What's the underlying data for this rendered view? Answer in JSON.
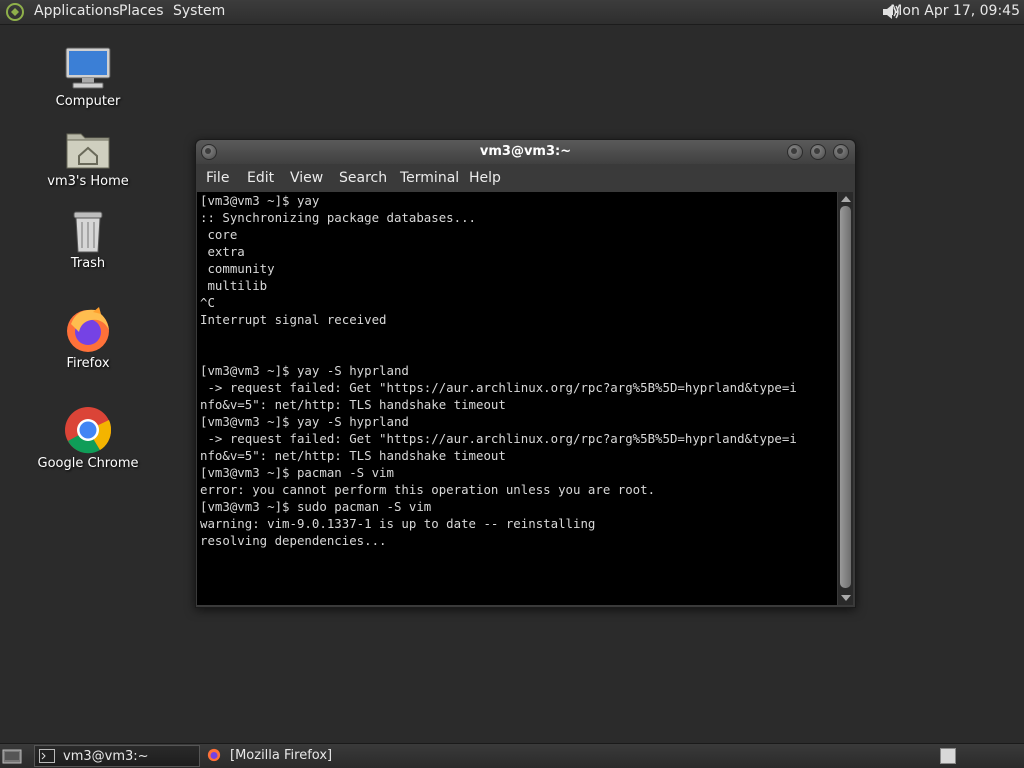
{
  "top_panel": {
    "menus": [
      "Applications",
      "Places",
      "System"
    ],
    "clock": "Mon Apr 17, 09:45",
    "logo_icon": "distro-logo-icon",
    "sound_icon": "speaker-icon"
  },
  "desktop_icons": [
    {
      "label": "Computer",
      "icon": "computer-icon"
    },
    {
      "label": "vm3's Home",
      "icon": "home-folder-icon"
    },
    {
      "label": "Trash",
      "icon": "trash-icon"
    },
    {
      "label": "Firefox",
      "icon": "firefox-icon"
    },
    {
      "label": "Google Chrome",
      "icon": "chrome-icon"
    }
  ],
  "window": {
    "title": "vm3@vm3:~",
    "menu": [
      "File",
      "Edit",
      "View",
      "Search",
      "Terminal",
      "Help"
    ],
    "terminal_lines": [
      "[vm3@vm3 ~]$ yay",
      ":: Synchronizing package databases...",
      " core",
      " extra",
      " community",
      " multilib",
      "^C",
      "Interrupt signal received",
      "",
      "",
      "[vm3@vm3 ~]$ yay -S hyprland",
      " -> request failed: Get \"https://aur.archlinux.org/rpc?arg%5B%5D=hyprland&type=i",
      "nfo&v=5\": net/http: TLS handshake timeout",
      "[vm3@vm3 ~]$ yay -S hyprland",
      " -> request failed: Get \"https://aur.archlinux.org/rpc?arg%5B%5D=hyprland&type=i",
      "nfo&v=5\": net/http: TLS handshake timeout",
      "[vm3@vm3 ~]$ pacman -S vim",
      "error: you cannot perform this operation unless you are root.",
      "[vm3@vm3 ~]$ sudo pacman -S vim",
      "warning: vim-9.0.1337-1 is up to date -- reinstalling",
      "resolving dependencies..."
    ]
  },
  "taskbar": {
    "tasks": [
      {
        "label": "vm3@vm3:~",
        "icon": "terminal-icon",
        "active": true
      },
      {
        "label": "[Mozilla Firefox]",
        "icon": "firefox-icon",
        "active": false
      }
    ]
  },
  "colors": {
    "desktop_bg": "#2b2b2b",
    "terminal_bg": "#000000",
    "terminal_fg": "#d8d8d8",
    "panel_bg": "#333333"
  }
}
